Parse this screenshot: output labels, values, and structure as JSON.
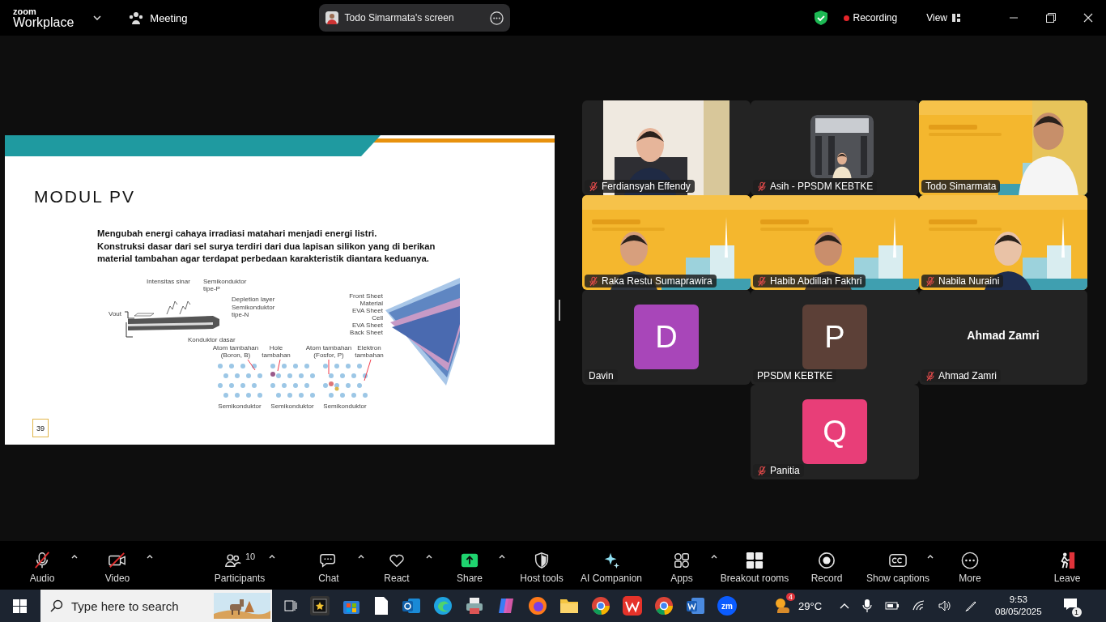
{
  "topbar": {
    "logo_top": "zoom",
    "logo_bottom": "Workplace",
    "meeting": "Meeting",
    "share_pill": "Todo Simarmata's screen",
    "recording": "Recording",
    "view": "View"
  },
  "slide": {
    "title": "MODUL PV",
    "body": [
      "Mengubah energi cahaya irradiasi matahari menjadi energi listri.",
      "Konstruksi dasar dari sel surya terdiri dari dua lapisan silikon yang di berikan material tambahan agar terdapat perbedaan karakteristik diantara keduanya."
    ],
    "diagram_labels": [
      {
        "lines": [
          "Vout"
        ]
      },
      {
        "lines": [
          "Intensitas sinar"
        ]
      },
      {
        "lines": [
          "Semikonduktor",
          "tipe-P"
        ]
      },
      {
        "lines": [
          "Depletion layer"
        ]
      },
      {
        "lines": [
          "Semikonduktor",
          "tipe-N"
        ]
      },
      {
        "lines": [
          "Konduktor dasar"
        ]
      },
      {
        "lines": [
          "Atom tambahan",
          "(Boron, B)"
        ]
      },
      {
        "lines": [
          "Hole",
          "tambahan"
        ]
      },
      {
        "lines": [
          "Atom tambahan",
          "(Fosfor, P)"
        ]
      },
      {
        "lines": [
          "Elektron",
          "tambahan"
        ]
      },
      {
        "lines": [
          "Semikonduktor"
        ]
      },
      {
        "lines": [
          "Semikonduktor"
        ]
      },
      {
        "lines": [
          "Semikonduktor"
        ]
      },
      {
        "lines": [
          "Front Sheet"
        ]
      },
      {
        "lines": [
          "Material"
        ]
      },
      {
        "lines": [
          "EVA Sheet"
        ]
      },
      {
        "lines": [
          "Cell"
        ]
      },
      {
        "lines": [
          "EVA Sheet"
        ]
      },
      {
        "lines": [
          "Back Sheet"
        ]
      }
    ],
    "page_number": "39"
  },
  "tiles": [
    {
      "kind": "video",
      "name": "Ferdiansyah Effendy",
      "muted": true,
      "speaking": false
    },
    {
      "kind": "video",
      "name": "Asih - PPSDM KEBTKE",
      "muted": true,
      "speaking": false
    },
    {
      "kind": "video",
      "name": "Todo Simarmata",
      "muted": false,
      "speaking": true
    },
    {
      "kind": "video",
      "name": "Raka Restu Sumaprawira",
      "muted": true,
      "speaking": false
    },
    {
      "kind": "video",
      "name": "Habib Abdillah Fakhri",
      "muted": true,
      "speaking": false
    },
    {
      "kind": "video",
      "name": "Nabila Nuraini",
      "muted": true,
      "speaking": false
    },
    {
      "kind": "avatar",
      "initial": "D",
      "color": "#a846b9",
      "name": "Davin",
      "muted": false,
      "speaking": false
    },
    {
      "kind": "avatar",
      "initial": "P",
      "color": "#5c4037",
      "name": "PPSDM KEBTKE",
      "muted": false,
      "speaking": false
    },
    {
      "kind": "name",
      "display_name": "Ahmad Zamri",
      "name": "Ahmad Zamri",
      "muted": true,
      "speaking": false
    },
    {
      "kind": "avatar",
      "initial": "Q",
      "color": "#e83e78",
      "name": "Panitia",
      "muted": true,
      "speaking": false
    }
  ],
  "toolbar": [
    {
      "label": "Audio",
      "menu": true,
      "off": true
    },
    {
      "label": "Video",
      "menu": true,
      "off": true
    },
    {
      "label": "Participants",
      "menu": true,
      "count": "10"
    },
    {
      "label": "Chat",
      "menu": true
    },
    {
      "label": "React",
      "menu": true
    },
    {
      "label": "Share",
      "menu": true
    },
    {
      "label": "Host tools",
      "menu": false
    },
    {
      "label": "AI Companion",
      "menu": false
    },
    {
      "label": "Apps",
      "menu": true
    },
    {
      "label": "Breakout rooms",
      "menu": false
    },
    {
      "label": "Record",
      "menu": false
    },
    {
      "label": "Show captions",
      "menu": true
    },
    {
      "label": "More",
      "menu": false
    },
    {
      "label": "Leave",
      "menu": false
    }
  ],
  "taskbar": {
    "search": {
      "placeholder": "Type here to search"
    },
    "zoom_icon": "zm",
    "weather_badge": "4",
    "temperature": "29°C",
    "time": "9:53",
    "date": "08/05/2025",
    "notification_count": "1"
  }
}
